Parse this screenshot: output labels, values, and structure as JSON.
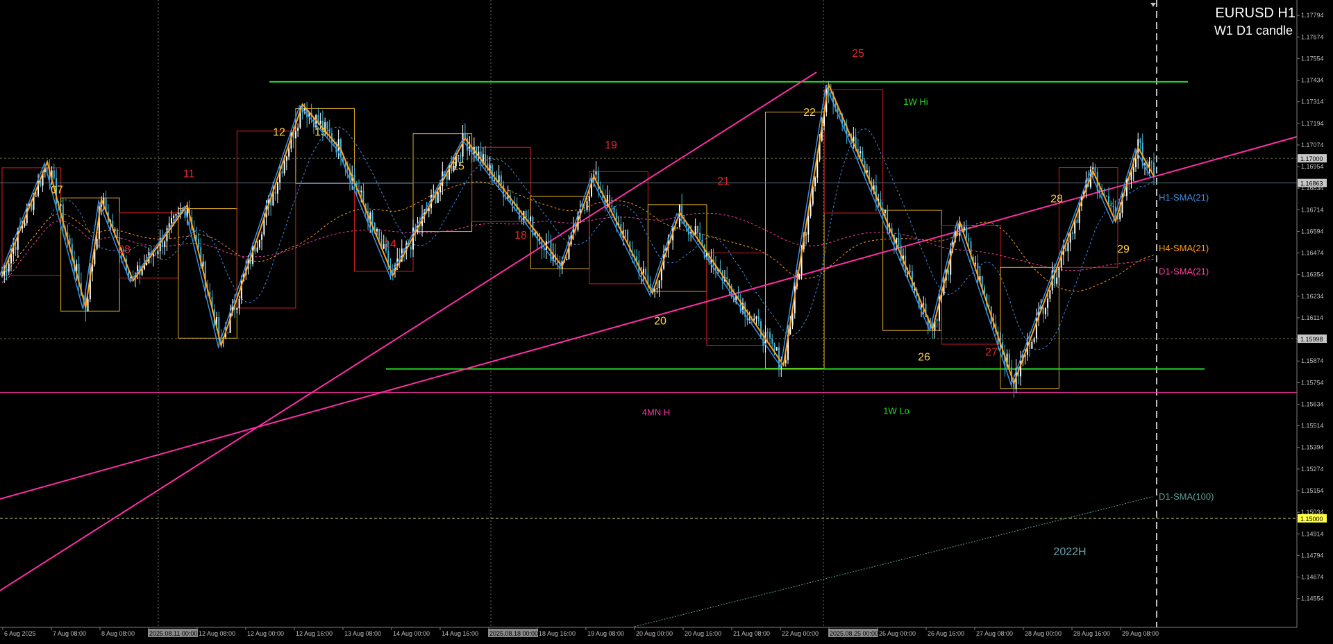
{
  "window": {
    "symbol_title": "EURUSD H1",
    "subtitle": "W1 D1 candle"
  },
  "colors": {
    "background": "#000000",
    "bull_candle": "#ffffff",
    "bear_candle": "#3fb6d8",
    "zigzag_orange": "#ffa31a",
    "zigzag_blue": "#3a8ee6",
    "trendline_pink": "#ff2fa8",
    "weekly_hilo_green": "#22dd22",
    "day_box_red": "#d21e1e",
    "day_box_yellow": "#e0b020",
    "sma_h1": "#3a8ee6",
    "sma_h4": "#ff9a1a",
    "sma_d1_21": "#ff3fa0",
    "sma_d1_100": "#5aa09a",
    "price_tag": "#c8c8c8",
    "level_tag": "#ffff40"
  },
  "chart_data": {
    "type": "candlestick",
    "symbol": "EURUSD",
    "timeframe": "H1",
    "ylim": [
      1.1441,
      1.17864
    ],
    "y_ticks": [
      "1.17794",
      "1.17674",
      "1.17554",
      "1.17434",
      "1.17314",
      "1.17194",
      "1.17074",
      "1.16954",
      "1.16834",
      "1.16714",
      "1.16594",
      "1.16474",
      "1.16354",
      "1.16234",
      "1.16114",
      "1.15994",
      "1.15874",
      "1.15754",
      "1.15634",
      "1.15514",
      "1.15394",
      "1.15274",
      "1.15154",
      "1.15034",
      "1.14914",
      "1.14794",
      "1.14674",
      "1.14554"
    ],
    "x_ticks": [
      "6 Aug 2025",
      "7 Aug 08:00",
      "8 Aug 08:00",
      "2025.08.11 00:00",
      "12 Aug 08:00",
      "12 Aug 00:00",
      "12 Aug 16:00",
      "13 Aug 08:00",
      "14 Aug 00:00",
      "14 Aug 16:00",
      "2025.08.18 00:00",
      "18 Aug 16:00",
      "19 Aug 08:00",
      "20 Aug 00:00",
      "20 Aug 16:00",
      "21 Aug 08:00",
      "22 Aug 00:00",
      "2025.08.25 00:00",
      "26 Aug 00:00",
      "26 Aug 16:00",
      "27 Aug 08:00",
      "28 Aug 00:00",
      "28 Aug 16:00",
      "29 Aug 08:00"
    ],
    "price_tags": [
      {
        "label": "1.17000",
        "value": 1.17
      },
      {
        "label": "1.16863",
        "value": 1.16863
      },
      {
        "label": "1.15998",
        "value": 1.15998
      },
      {
        "label": "1.15000",
        "value": 1.15
      }
    ],
    "horizontal_levels": [
      {
        "name": "1W Hi",
        "value": 1.17425
      },
      {
        "name": "1W Lo",
        "value": 1.1583
      },
      {
        "name": "4MN H",
        "value": 1.157
      },
      {
        "name": "2022H",
        "value": 1.15
      }
    ],
    "day_labels": [
      {
        "text": "07",
        "high": false
      },
      {
        "text": "08",
        "high": true
      },
      {
        "text": "11",
        "high": true
      },
      {
        "text": "12",
        "high": false
      },
      {
        "text": "13",
        "high": false
      },
      {
        "text": "14",
        "high": true
      },
      {
        "text": "15",
        "high": false
      },
      {
        "text": "18",
        "high": true
      },
      {
        "text": "19",
        "high": true
      },
      {
        "text": "20",
        "high": false
      },
      {
        "text": "21",
        "high": true
      },
      {
        "text": "22",
        "high": false
      },
      {
        "text": "25",
        "high": true
      },
      {
        "text": "26",
        "high": false
      },
      {
        "text": "27",
        "high": true
      },
      {
        "text": "28",
        "high": false
      },
      {
        "text": "29",
        "high": false
      }
    ],
    "swing_points": [
      {
        "t": 0,
        "p": 1.1635
      },
      {
        "t": 20,
        "p": 1.1698
      },
      {
        "t": 37,
        "p": 1.1617
      },
      {
        "t": 44,
        "p": 1.1677
      },
      {
        "t": 58,
        "p": 1.1632
      },
      {
        "t": 82,
        "p": 1.1674
      },
      {
        "t": 97,
        "p": 1.1596
      },
      {
        "t": 133,
        "p": 1.173
      },
      {
        "t": 150,
        "p": 1.1705
      },
      {
        "t": 173,
        "p": 1.1635
      },
      {
        "t": 205,
        "p": 1.1711
      },
      {
        "t": 248,
        "p": 1.164
      },
      {
        "t": 262,
        "p": 1.169
      },
      {
        "t": 288,
        "p": 1.1625
      },
      {
        "t": 300,
        "p": 1.167
      },
      {
        "t": 346,
        "p": 1.1585
      },
      {
        "t": 366,
        "p": 1.1741
      },
      {
        "t": 412,
        "p": 1.1605
      },
      {
        "t": 424,
        "p": 1.1665
      },
      {
        "t": 448,
        "p": 1.1575
      },
      {
        "t": 483,
        "p": 1.1693
      },
      {
        "t": 493,
        "p": 1.1665
      },
      {
        "t": 503,
        "p": 1.1706
      },
      {
        "t": 510,
        "p": 1.169
      }
    ],
    "indicators": [
      {
        "name": "H1-SMA(21)",
        "last": 1.1678
      },
      {
        "name": "H4-SMA(21)",
        "last": 1.165
      },
      {
        "name": "D1-SMA(21)",
        "last": 1.1637
      },
      {
        "name": "D1-SMA(100)",
        "last": 1.1512
      }
    ],
    "grid": true
  }
}
